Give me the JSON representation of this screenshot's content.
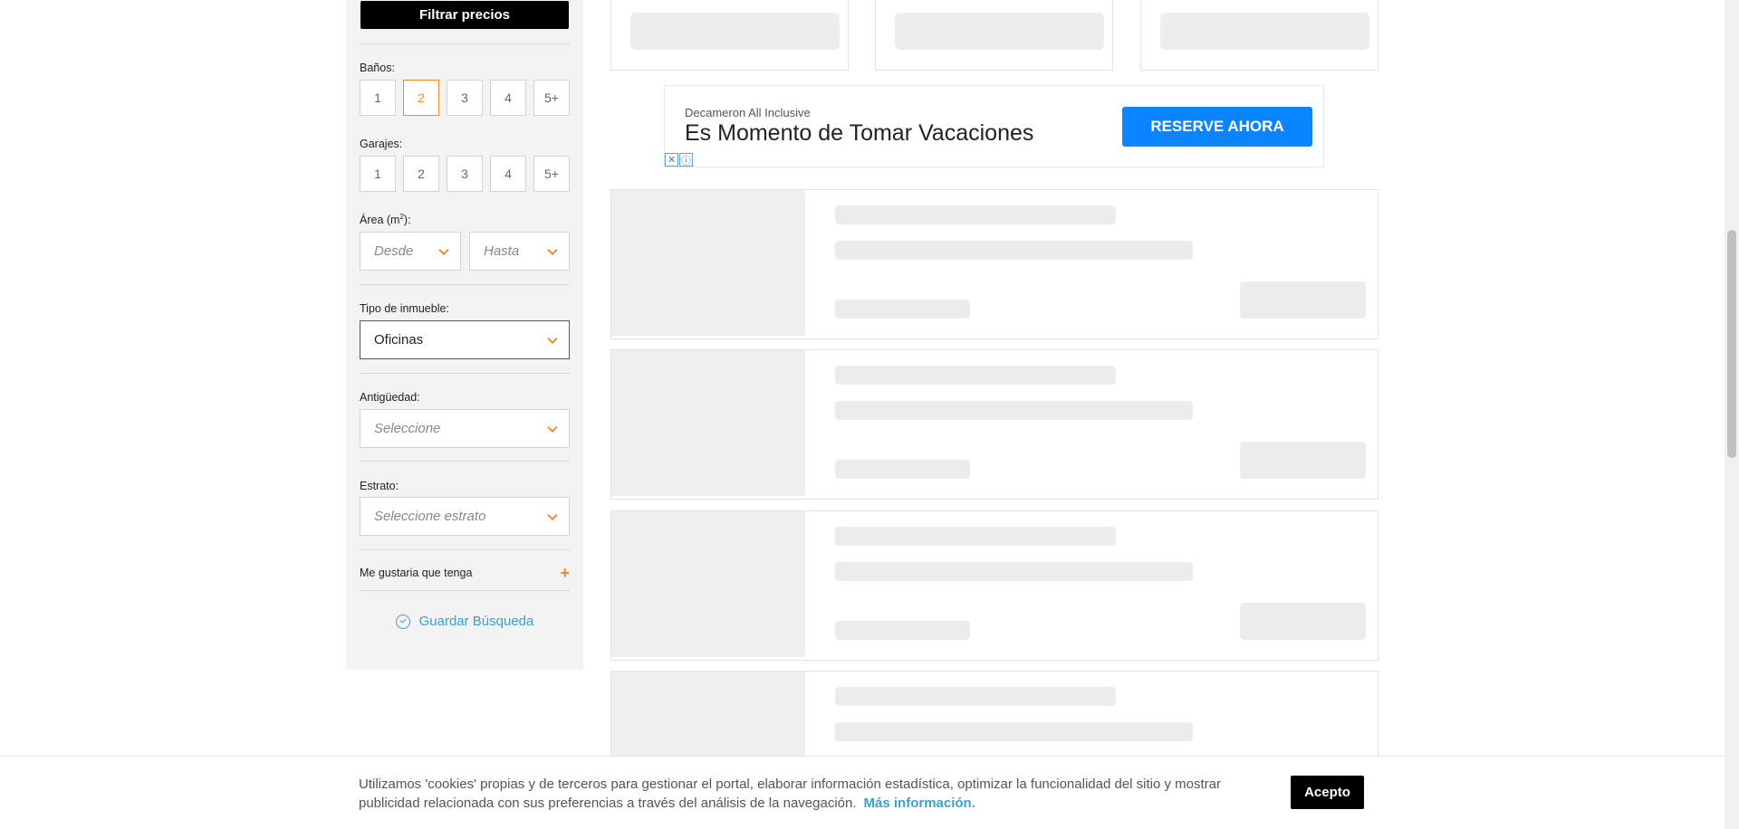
{
  "sidebar": {
    "filter_button": "Filtrar precios",
    "banos": {
      "label": "Baños:",
      "options": [
        "1",
        "2",
        "3",
        "4",
        "5+"
      ],
      "selected": "2"
    },
    "garajes": {
      "label": "Garajes:",
      "options": [
        "1",
        "2",
        "3",
        "4",
        "5+"
      ]
    },
    "area": {
      "label": "Área (m",
      "label_sup": "2",
      "label_end": "):",
      "from_placeholder": "Desde",
      "to_placeholder": "Hasta"
    },
    "tipo": {
      "label": "Tipo de inmueble:",
      "value": "Oficinas"
    },
    "antiguedad": {
      "label": "Antigüedad:",
      "placeholder": "Seleccione"
    },
    "estrato": {
      "label": "Estrato:",
      "placeholder": "Seleccione estrato"
    },
    "wish": {
      "label": "Me gustaria que tenga",
      "toggle": "+"
    },
    "save_search": "Guardar Búsqueda"
  },
  "ad": {
    "brand": "Decameron All Inclusive",
    "headline": "Es Momento de Tomar Vacaciones",
    "cta": "RESERVE AHORA",
    "close_glyph": "✕",
    "info_glyph": "ⓘ"
  },
  "cookie": {
    "text": "Utilizamos 'cookies' propias y de terceros para gestionar el portal, elaborar información estadística, optimizar la funcionalidad del sitio y mostrar publicidad relacionada con sus preferencias a través del análisis de la navegación.",
    "link": "Más información.",
    "accept": "Acepto"
  },
  "colors": {
    "accent": "#f08a24",
    "link": "#3b9fd0",
    "ad_button": "#0a84ff"
  }
}
